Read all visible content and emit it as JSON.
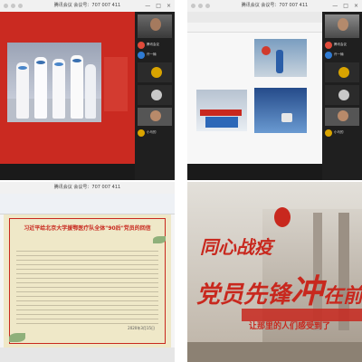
{
  "meeting": {
    "title": "腾讯会议 会议号：707 007 411",
    "win_controls": [
      "—",
      "□",
      "×"
    ]
  },
  "tile1": {
    "participants": [
      "腾讯会议",
      "许一楠",
      "",
      "",
      "小马的"
    ]
  },
  "tile2": {
    "participants": [
      "腾讯会议",
      "许一楠",
      "",
      "",
      "小马的"
    ]
  },
  "tile3": {
    "doc_title": "习近平给北京大学援鄂医疗队全体\"90后\"党员的回信",
    "doc_date": "2020年3月15日"
  },
  "tile4": {
    "line1": "同心战疫",
    "line2a": "党员先锋",
    "line2b": "冲",
    "line2c": "在前",
    "sub": "让那里的人们感受到了"
  },
  "colors": {
    "brand_red": "#c8281e",
    "avatar_gold": "#d9a400"
  }
}
